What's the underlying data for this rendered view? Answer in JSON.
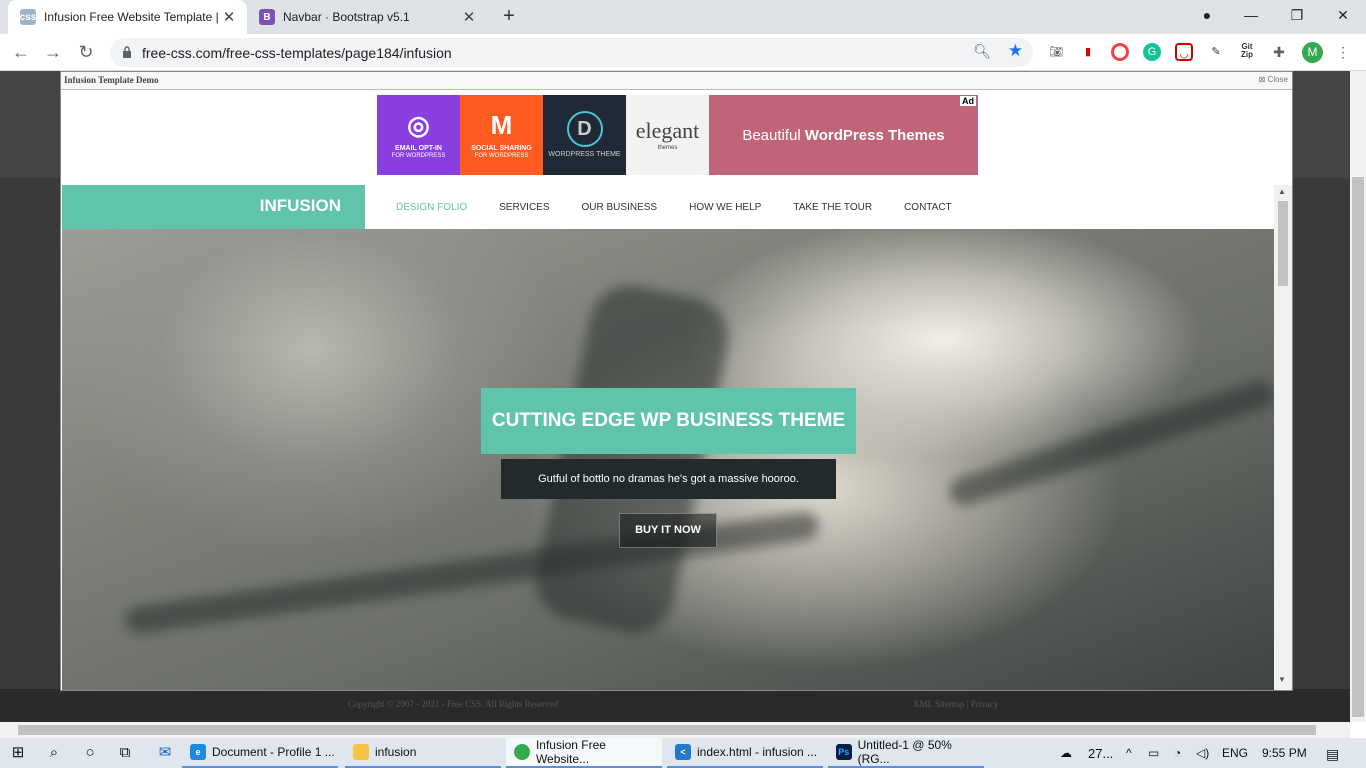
{
  "browser": {
    "tabs": [
      {
        "title": "Infusion Free Website Template |",
        "icon": "css-favicon"
      },
      {
        "title": "Navbar · Bootstrap v5.1",
        "icon": "B"
      }
    ],
    "url": "free-css.com/free-css-templates/page184/infusion",
    "profile_initial": "M",
    "ext_labels": {
      "gitzip": "Git Zip"
    }
  },
  "demo_frame": {
    "header_title": "Infusion Template Demo",
    "close_label": "Close"
  },
  "ad": {
    "tiles": [
      {
        "label": "EMAIL OPT-IN",
        "sub": "FOR WORDPRESS",
        "color": "#8a3ee0",
        "icon": "◎"
      },
      {
        "label": "SOCIAL SHARING",
        "sub": "FOR WORDPRESS",
        "color": "#ff5a1f",
        "icon": "M"
      },
      {
        "label": "WORDPRESS THEME",
        "sub": "",
        "color": "#1f2a36",
        "icon": "D"
      },
      {
        "label": "elegant",
        "sub": "themes",
        "color": "#f2f2f2",
        "icon": ""
      }
    ],
    "banner_text_light": "Beautiful ",
    "banner_text_bold": "WordPress Themes",
    "tag": "Ad"
  },
  "site": {
    "brand": "INFUSION",
    "menu": [
      "DESIGN FOLIO",
      "SERVICES",
      "OUR BUSINESS",
      "HOW WE HELP",
      "TAKE THE TOUR",
      "CONTACT"
    ],
    "hero_title": "CUTTING EDGE WP BUSINESS THEME",
    "hero_subtitle": "Gutful of bottlo no dramas he's got a massive hooroo.",
    "hero_button": "BUY IT NOW"
  },
  "page_footer": {
    "copyright": "Copyright © 2007 - 2021 - Free CSS. All Rights Reserved",
    "links": "XML Sitemap | Privacy"
  },
  "taskbar": {
    "apps": [
      {
        "label": "Document - Profile 1 ...",
        "color": "#1e88e5"
      },
      {
        "label": "infusion",
        "color": "#f6c445"
      },
      {
        "label": "Infusion Free Website...",
        "color": "#34a853"
      },
      {
        "label": "index.html - infusion ...",
        "color": "#2478cc"
      },
      {
        "label": "Untitled-1 @ 50% (RG...",
        "color": "#0a1f44"
      }
    ],
    "weather": "27...",
    "lang": "ENG",
    "time": "9:55 PM"
  },
  "colors": {
    "accent": "#5fc4ab",
    "dark": "#232a2c"
  }
}
